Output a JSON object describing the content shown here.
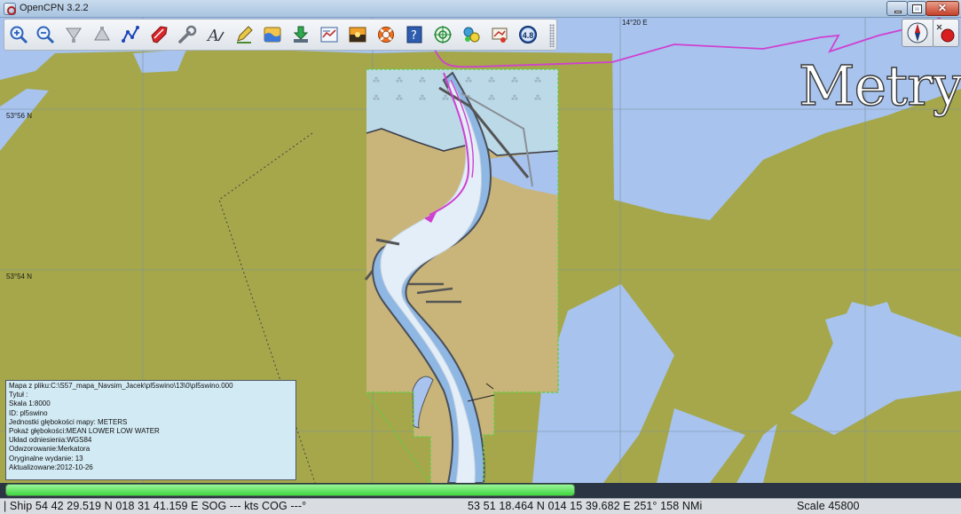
{
  "window": {
    "title": "OpenCPN 3.2.2",
    "controls": {
      "minimize": "minimize-icon",
      "maximize": "maximize-icon",
      "close": "✕"
    }
  },
  "toolbar": {
    "tools": [
      {
        "id": "zoom-in",
        "icon": "zoom-in-icon"
      },
      {
        "id": "zoom-out",
        "icon": "zoom-out-icon"
      },
      {
        "id": "scale-in",
        "icon": "scale-in-icon"
      },
      {
        "id": "scale-out",
        "icon": "scale-out-icon"
      },
      {
        "id": "route",
        "icon": "route-icon"
      },
      {
        "id": "follow",
        "icon": "ship-icon"
      },
      {
        "id": "settings",
        "icon": "wrench-icon"
      },
      {
        "id": "text",
        "icon": "text-icon"
      },
      {
        "id": "current",
        "icon": "pencil-icon"
      },
      {
        "id": "tides",
        "icon": "tide-icon"
      },
      {
        "id": "current-arrow",
        "icon": "current-icon"
      },
      {
        "id": "route-manager",
        "icon": "route-manager-icon"
      },
      {
        "id": "color-scheme",
        "icon": "color-scheme-icon"
      },
      {
        "id": "mob",
        "icon": "lifebuoy-icon"
      },
      {
        "id": "help",
        "icon": "help-icon"
      },
      {
        "id": "radar",
        "icon": "target-icon"
      },
      {
        "id": "ais",
        "icon": "ais-icon"
      },
      {
        "id": "print",
        "icon": "print-icon"
      }
    ],
    "version_badge": "4.8"
  },
  "chart": {
    "lat_top": "53°56 N",
    "lat_mid": "53°54 N",
    "lon_top": "14°20 E",
    "depth_units_label": "Metry",
    "colors": {
      "deep_water": "#a7c3ee",
      "land": "#a5a74a",
      "harbor_land": "#c9b47a",
      "shallow": "#bcd9e8",
      "channel": "#e3eef8",
      "track": "#d040d0",
      "chart_boundary": "#66cc44"
    }
  },
  "chart_info": {
    "lines": [
      "Mapa z pliku:C:\\S57_mapa_Navsim_Jacek\\pl5swino\\13\\0\\pl5swino.000",
      "Tytuł :",
      "Skala 1:8000",
      "ID: pl5swino",
      "Jednostki głębokości mapy: METERS",
      "Pokaż głębokości:MEAN LOWER LOW WATER",
      "Układ odniesienia:WGS84",
      "Odwzorowanie:Merkatora",
      "Oryginalne wydanie: 13",
      "Aktualizowane:2012-10-26"
    ]
  },
  "progress": {
    "fraction": 1.0
  },
  "statusbar": {
    "ship": "| Ship 54 42 29.519 N   018 31 41.159 E    SOG --- kts  COG ---°",
    "cursor": "53 51 18.464 N   014 15 39.682 E  251°  158 NMi",
    "scale": "Scale 45800"
  }
}
